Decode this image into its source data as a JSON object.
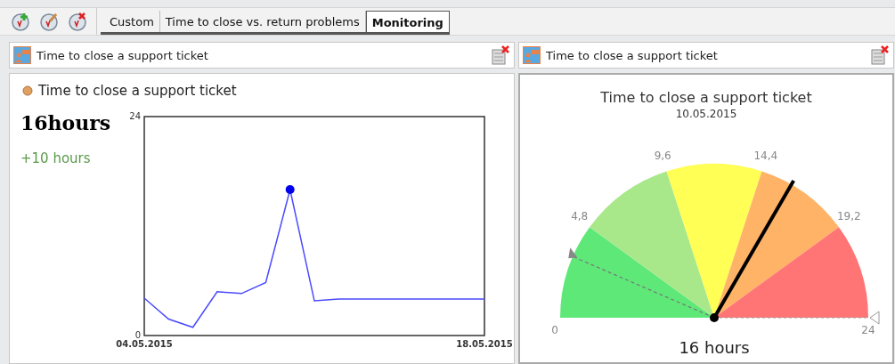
{
  "toolbar": {
    "buttons": [
      {
        "kind": "add"
      },
      {
        "kind": "edit"
      },
      {
        "kind": "delete"
      }
    ]
  },
  "tabs": [
    {
      "label": "Custom",
      "selected": false
    },
    {
      "label": "Time to close vs. return problems",
      "selected": false
    },
    {
      "label": "Monitoring",
      "selected": true
    }
  ],
  "left_panel": {
    "header": "Time to close a support ticket",
    "title": "Time to close a support ticket",
    "value": "16hours",
    "change": "+10 hours",
    "chart_data": {
      "type": "line",
      "categories": [
        "04.05.2015",
        null,
        null,
        null,
        null,
        null,
        null,
        null,
        null,
        null,
        null,
        null,
        null,
        null,
        "18.05.2015"
      ],
      "ylim": [
        0,
        24
      ],
      "yticks": [
        {
          "value": 0,
          "label": "0"
        },
        {
          "value": 24,
          "label": "24"
        }
      ],
      "series": [
        {
          "color": "#4a4aff",
          "values": [
            4.1,
            1.8,
            0.9,
            4.8,
            4.6,
            5.8,
            16,
            3.8,
            4,
            4,
            4,
            4,
            4,
            4,
            4
          ]
        }
      ]
    }
  },
  "right_panel": {
    "header": "Time to close a support ticket",
    "title": "Time to close a support ticket",
    "date": "10.05.2015",
    "reading": "16 hours",
    "gauge": {
      "segments": [
        {
          "color": "#5ee878"
        },
        {
          "color": "#a8e88a"
        },
        {
          "color": "#ffff55"
        },
        {
          "color": "#ffb366"
        },
        {
          "color": "#ff7575"
        }
      ],
      "tick_labels": [
        "0",
        "4,8",
        "9,6",
        "14,4",
        "19,2",
        "24"
      ]
    }
  }
}
